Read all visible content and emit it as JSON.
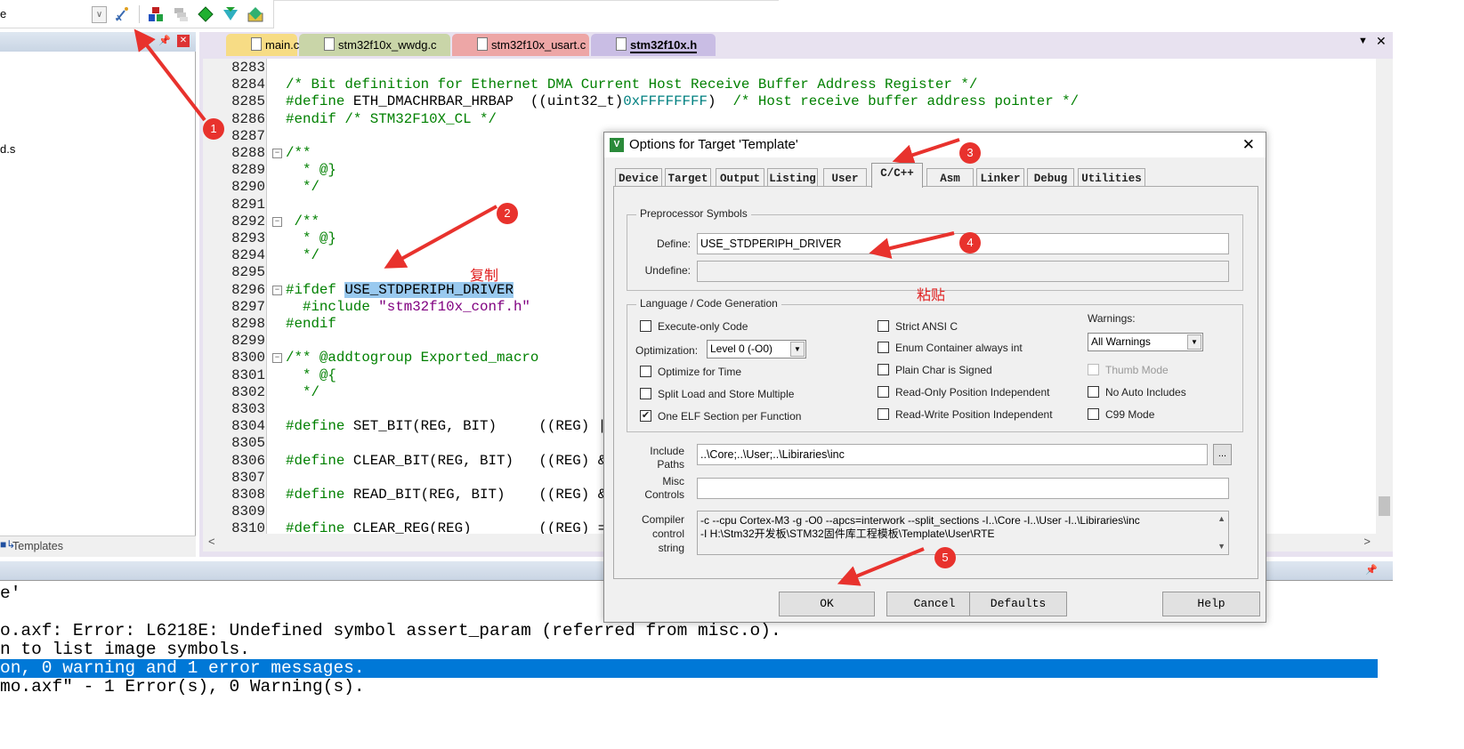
{
  "toolbar": {
    "combo_text": "e",
    "icons": [
      "dropdown-arrow-icon",
      "wand-icon",
      "build-target-icon",
      "batch-icon",
      "download-icon",
      "debug-icon",
      "flash-icon"
    ]
  },
  "left_panel": {
    "file_item": "d.s",
    "bottom_tab": "Templates"
  },
  "editor": {
    "tabs": [
      {
        "label": "main.c",
        "color": "#f7dc85"
      },
      {
        "label": "stm32f10x_wwdg.c",
        "color": "#c9d5a8"
      },
      {
        "label": "stm32f10x_usart.c",
        "color": "#eda6a6"
      },
      {
        "label": "stm32f10x.h",
        "color": "#c9bde4",
        "active": true
      }
    ],
    "lines": [
      {
        "n": "8283",
        "s": []
      },
      {
        "n": "8284",
        "s": [
          {
            "c": "cm",
            "t": "/* Bit definition for Ethernet DMA Current Host Receive Buffer Address Register */"
          }
        ]
      },
      {
        "n": "8285",
        "s": [
          {
            "c": "dir",
            "t": "#define"
          },
          {
            "c": "plain",
            "t": " ETH_DMACHRBAR_HRBAP  ((uint32_t)"
          },
          {
            "c": "num",
            "t": "0xFFFFFFFF"
          },
          {
            "c": "plain",
            "t": ")  "
          },
          {
            "c": "cm",
            "t": "/* Host receive buffer address pointer */"
          }
        ]
      },
      {
        "n": "8286",
        "s": [
          {
            "c": "dir",
            "t": "#endif /* STM32F10X_CL */"
          }
        ]
      },
      {
        "n": "8287",
        "s": []
      },
      {
        "n": "8288",
        "fold": true,
        "s": [
          {
            "c": "cm",
            "t": "/**"
          }
        ]
      },
      {
        "n": "8289",
        "s": [
          {
            "c": "cm",
            "t": "  * @}"
          }
        ]
      },
      {
        "n": "8290",
        "s": [
          {
            "c": "cm",
            "t": "  */"
          }
        ]
      },
      {
        "n": "8291",
        "s": []
      },
      {
        "n": "8292",
        "fold": true,
        "s": [
          {
            "c": "cm",
            "t": " /**"
          }
        ]
      },
      {
        "n": "8293",
        "s": [
          {
            "c": "cm",
            "t": "  * @}"
          }
        ]
      },
      {
        "n": "8294",
        "s": [
          {
            "c": "cm",
            "t": "  */"
          }
        ]
      },
      {
        "n": "8295",
        "s": []
      },
      {
        "n": "8296",
        "fold": true,
        "s": [
          {
            "c": "dir",
            "t": "#ifdef "
          },
          {
            "c": "sel",
            "t": "USE_STDPERIPH_DRIVER"
          }
        ]
      },
      {
        "n": "8297",
        "s": [
          {
            "c": "dir",
            "t": "  #include "
          },
          {
            "c": "str",
            "t": "\"stm32f10x_conf.h\""
          }
        ]
      },
      {
        "n": "8298",
        "s": [
          {
            "c": "dir",
            "t": "#endif"
          }
        ]
      },
      {
        "n": "8299",
        "s": []
      },
      {
        "n": "8300",
        "fold": true,
        "s": [
          {
            "c": "cm",
            "t": "/** @addtogroup Exported_macro"
          }
        ]
      },
      {
        "n": "8301",
        "s": [
          {
            "c": "cm",
            "t": "  * @{"
          }
        ]
      },
      {
        "n": "8302",
        "s": [
          {
            "c": "cm",
            "t": "  */"
          }
        ]
      },
      {
        "n": "8303",
        "s": []
      },
      {
        "n": "8304",
        "s": [
          {
            "c": "dir",
            "t": "#define"
          },
          {
            "c": "plain",
            "t": " SET_BIT(REG, BIT)     ((REG) |"
          }
        ]
      },
      {
        "n": "8305",
        "s": []
      },
      {
        "n": "8306",
        "s": [
          {
            "c": "dir",
            "t": "#define"
          },
          {
            "c": "plain",
            "t": " CLEAR_BIT(REG, BIT)   ((REG) &"
          }
        ]
      },
      {
        "n": "8307",
        "s": []
      },
      {
        "n": "8308",
        "s": [
          {
            "c": "dir",
            "t": "#define"
          },
          {
            "c": "plain",
            "t": " READ_BIT(REG, BIT)    ((REG) &"
          }
        ]
      },
      {
        "n": "8309",
        "s": []
      },
      {
        "n": "8310",
        "s": [
          {
            "c": "dir",
            "t": "#define"
          },
          {
            "c": "plain",
            "t": " CLEAR_REG(REG)        ((REG) ="
          }
        ]
      }
    ]
  },
  "output": {
    "lines": [
      {
        "t": "e'"
      },
      {
        "t": ""
      },
      {
        "t": "o.axf: Error: L6218E: Undefined symbol assert_param (referred from misc.o)."
      },
      {
        "t": "n to list image symbols."
      },
      {
        "t": "on, 0 warning and 1 error messages.",
        "hl": true
      },
      {
        "t": "mo.axf\" - 1 Error(s), 0 Warning(s)."
      }
    ]
  },
  "dialog": {
    "title": "Options for Target 'Template'",
    "tabs": [
      "Device",
      "Target",
      "Output",
      "Listing",
      "User",
      "C/C++",
      "Asm",
      "Linker",
      "Debug",
      "Utilities"
    ],
    "active_tab": "C/C++",
    "preprocessor": {
      "group": "Preprocessor Symbols",
      "define_label": "Define:",
      "define_value": "USE_STDPERIPH_DRIVER",
      "undefine_label": "Undefine:",
      "undefine_value": ""
    },
    "language": {
      "group": "Language / Code Generation",
      "execute_only": {
        "label": "Execute-only Code",
        "checked": false
      },
      "optimization_label": "Optimization:",
      "optimization_value": "Level 0 (-O0)",
      "optimize_time": {
        "label": "Optimize for Time",
        "checked": false
      },
      "split_load": {
        "label": "Split Load and Store Multiple",
        "checked": false
      },
      "one_elf": {
        "label": "One ELF Section per Function",
        "checked": true
      },
      "strict_ansi": {
        "label": "Strict ANSI C",
        "checked": false
      },
      "enum_container": {
        "label": "Enum Container always int",
        "checked": false
      },
      "plain_char": {
        "label": "Plain Char is Signed",
        "checked": false
      },
      "ro_pi": {
        "label": "Read-Only Position Independent",
        "checked": false
      },
      "rw_pi": {
        "label": "Read-Write Position Independent",
        "checked": false
      },
      "warnings_label": "Warnings:",
      "warnings_value": "All Warnings",
      "thumb_mode": {
        "label": "Thumb Mode",
        "checked": false,
        "disabled": true
      },
      "no_auto_includes": {
        "label": "No Auto Includes",
        "checked": false
      },
      "c99": {
        "label": "C99 Mode",
        "checked": false
      }
    },
    "include_label_1": "Include",
    "include_label_2": "Paths",
    "include_value": "..\\Core;..\\User;..\\Libiraries\\inc",
    "browse_label": "...",
    "misc_label_1": "Misc",
    "misc_label_2": "Controls",
    "misc_value": "",
    "compiler_label_1": "Compiler",
    "compiler_label_2": "control",
    "compiler_label_3": "string",
    "compiler_line_1": "-c --cpu Cortex-M3 -g -O0 --apcs=interwork --split_sections -I..\\Core -I..\\User -I..\\Libiraries\\inc",
    "compiler_line_2": "-I H:\\Stm32开发板\\STM32固件库工程模板\\Template\\User\\RTE",
    "buttons": {
      "ok": "OK",
      "cancel": "Cancel",
      "defaults": "Defaults",
      "help": "Help"
    }
  },
  "annotations": {
    "steps": [
      "1",
      "2",
      "3",
      "4",
      "5"
    ],
    "copy_note": "复制",
    "paste_note": "粘贴",
    "color": "#e8322d"
  }
}
